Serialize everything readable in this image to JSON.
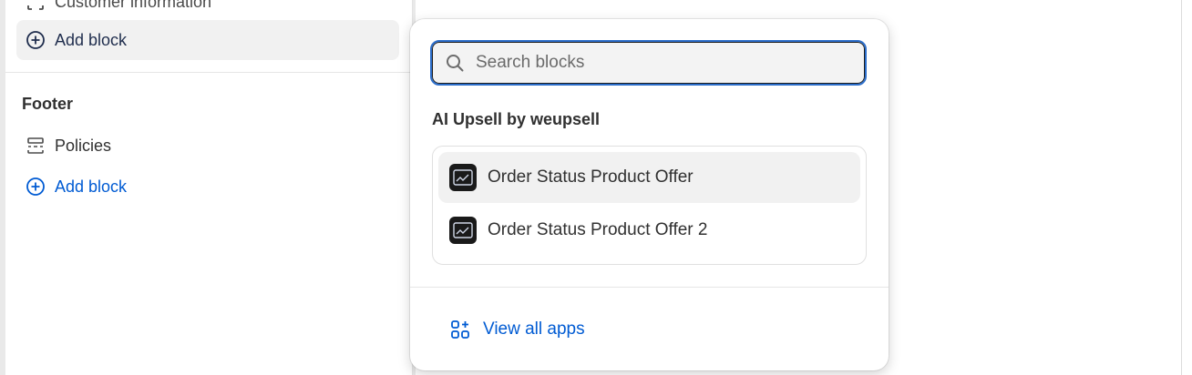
{
  "sidebar": {
    "cut_row_label": "Customer information",
    "add_block_label_1": "Add block",
    "footer_title": "Footer",
    "policies_label": "Policies",
    "add_block_label_2": "Add block"
  },
  "popover": {
    "search_placeholder": "Search blocks",
    "search_value": "",
    "group_title": "AI Upsell by weupsell",
    "items": [
      {
        "label": "Order Status Product Offer",
        "icon": "app-chart-icon",
        "selected": true
      },
      {
        "label": "Order Status Product Offer 2",
        "icon": "app-chart-icon",
        "selected": false
      }
    ],
    "view_all_label": "View all apps"
  },
  "colors": {
    "link": "#005bd3",
    "focus": "#2c6ecb",
    "selected_bg": "#f1f1f1",
    "text": "#303030"
  }
}
